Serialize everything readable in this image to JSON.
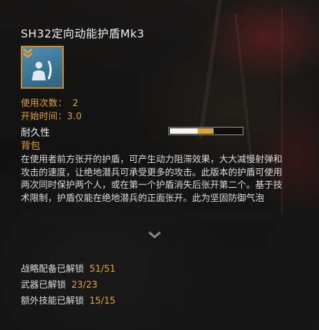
{
  "item": {
    "title": "SH32定向动能护盾Mk3",
    "icon": "stealth-soldier-shield-icon",
    "uses_label": "使用次数：",
    "uses_value": "2",
    "start_time_label": "开始时间：",
    "start_time_value": "3.0",
    "durability_label": "耐久性",
    "durability": {
      "current": 0.38,
      "segment_two": 0.22
    },
    "category": "背包",
    "description": "在使用者前方张开的护盾，可产生动力阻滞效果，大大减慢射弹和攻击的速度，让绝地潜兵可承受更多的攻击。此版本的护盾可使用两次同时保护两个人，或在第一个护盾消失后张开第二个。基于技术限制，护盾仅能在绝地潜兵的正面张开。此为坚固防御气泡"
  },
  "unlocks": [
    {
      "label": "战略配备已解锁",
      "count": "51/51"
    },
    {
      "label": "武器已解锁",
      "count": "23/23"
    },
    {
      "label": "额外技能已解锁",
      "count": "15/15"
    }
  ],
  "colors": {
    "accent": "#e6a324",
    "icon_bg": "#3a7595",
    "icon_border": "#d98a1c"
  }
}
